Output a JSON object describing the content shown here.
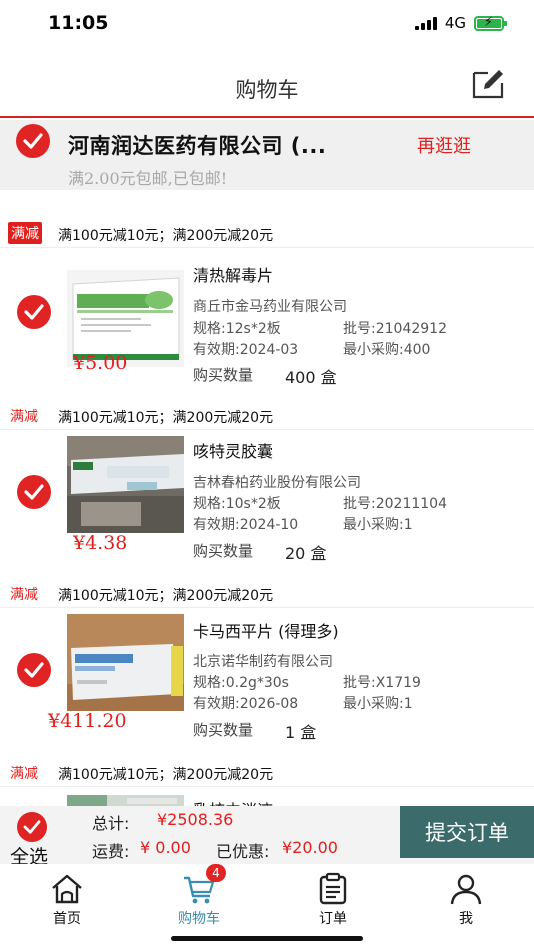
{
  "status": {
    "time": "11:05",
    "network": "4G"
  },
  "nav": {
    "title": "购物车"
  },
  "shop": {
    "name": "河南润达医药有限公司 (...",
    "more_label": "再逛逛",
    "shipping_note": "满2.00元包邮,已包邮!"
  },
  "promo_header": {
    "tag": "满减",
    "text": "满100元减10元；满200元减20元"
  },
  "items": [
    {
      "name": "清热解毒片",
      "maker": "商丘市金马药业有限公司",
      "spec": "规格:12s*2板",
      "batch": "批号:21042912",
      "expiry": "有效期:2024-03",
      "min_buy": "最小采购:400",
      "qty_label": "购买数量",
      "qty": "400 盒",
      "price": "¥5.00",
      "promo_tag": "满减",
      "promo_text": "满100元减10元；满200元减20元"
    },
    {
      "name": "咳特灵胶囊",
      "maker": "吉林春柏药业股份有限公司",
      "spec": "规格:10s*2板",
      "batch": "批号:20211104",
      "expiry": "有效期:2024-10",
      "min_buy": "最小采购:1",
      "qty_label": "购买数量",
      "qty": "20 盒",
      "price": "¥4.38",
      "promo_tag": "满减",
      "promo_text": "满100元减10元；满200元减20元"
    },
    {
      "name": "卡马西平片 (得理多)",
      "maker": "北京诺华制药有限公司",
      "spec": "规格:0.2g*30s",
      "batch": "批号:X1719",
      "expiry": "有效期:2026-08",
      "min_buy": "最小采购:1",
      "qty_label": "购买数量",
      "qty": "1 盒",
      "price": "¥411.20",
      "promo_tag": "满减",
      "promo_text": "满100元减10元；满200元减20元"
    },
    {
      "name": "乳核内消液"
    }
  ],
  "summary": {
    "select_all": "全选",
    "total_label": "总计:",
    "total": "¥2508.36",
    "shipping_label": "运费:",
    "shipping": "¥ 0.00",
    "discount_label": "已优惠:",
    "discount": "¥20.00",
    "submit": "提交订单"
  },
  "tabs": [
    {
      "label": "首页"
    },
    {
      "label": "购物车",
      "badge": "4"
    },
    {
      "label": "订单"
    },
    {
      "label": "我"
    }
  ],
  "colors": {
    "accent_red": "#e0201e",
    "submit_bg": "#3b6b6b",
    "tab_active": "#3a8db0"
  }
}
